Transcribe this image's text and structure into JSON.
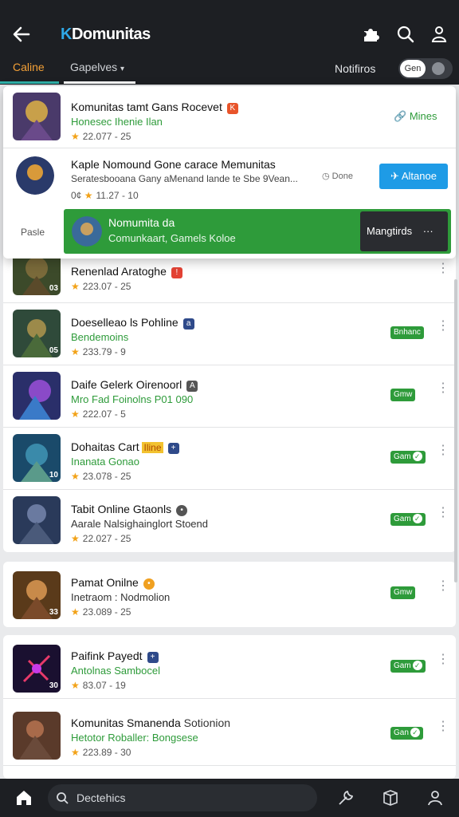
{
  "header": {
    "title_k": "K",
    "title_rest": "Domunitas",
    "back_icon": "back-arrow-icon",
    "icons": [
      "puzzle-icon",
      "search-icon",
      "user-icon"
    ]
  },
  "tabs": {
    "active": "Caline",
    "second": "Gapelves",
    "notifications_label": "Notifiros",
    "toggle_label": "Gen"
  },
  "popup": {
    "row1": {
      "title": "Komunitas tamt Gans Rocevet",
      "badge": "K",
      "sub": "Honesec Ihenie Ilan",
      "meta": "22.077 - 25",
      "action": "Mines"
    },
    "row2": {
      "title": "Kaple Nomound Gone carace Memunitas",
      "desc": "Seratesbooana Gany aMenand lande te Sbe 9Vean...",
      "done": "Done",
      "meta": "11.27 - 10",
      "meta_prefix": "0¢",
      "button": "Altanoe"
    },
    "paste_label": "Pasle",
    "toast": {
      "title": "Nomumita da",
      "subtitle": "Comunkaart, Gamels Koloe",
      "action": "Mangtirds",
      "more": "···"
    }
  },
  "list": [
    {
      "title": "Renenlad Aratoghe",
      "badge": "!",
      "badge_color": "#e34234",
      "sub": "",
      "meta": "223.07 - 25",
      "status": "",
      "level": "03"
    },
    {
      "title": "Doeselleao ls Pohline",
      "badge": "a",
      "badge_color": "#2f4a8a",
      "sub": "Bendemoins",
      "meta": "233.79 - 9",
      "status": "Bnhanc",
      "level": "05"
    },
    {
      "title": "Daife Gelerk Oirenoorl",
      "badge": "A",
      "badge_color": "#555",
      "sub": "Mro Fad Foinolns P01 090",
      "meta": "222.07 - 5",
      "status": "Gmw",
      "level": ""
    },
    {
      "title": "Dohaitas Cart",
      "badge_text": "Iline",
      "badge": "+",
      "badge_color": "#2f4a8a",
      "sub": "Inanata Gonao",
      "meta": "23.078 - 25",
      "status": "Gam",
      "level": "10"
    },
    {
      "title": "Tabit Online Gtaonls",
      "badge": "•",
      "badge_color": "#555",
      "sub": "Aarale Nalsighainglort Stoend",
      "meta": "22.027 - 25",
      "status": "Gam",
      "level": ""
    },
    {
      "title": "Pamat Onilne",
      "badge": "•",
      "badge_color": "#f0a020",
      "sub": "Inetraom : Nodmolion",
      "meta": "23.089 - 25",
      "status": "Gmw",
      "level": "33"
    },
    {
      "title": "Paifink Payedt",
      "badge": "+",
      "badge_color": "#2f4a8a",
      "sub": "Antolnas Sambocel",
      "meta": "83.07 - 19",
      "status": "Gam",
      "level": "30"
    },
    {
      "title": "Komunitas Smanenda",
      "badge_text": "Sotionion",
      "badge": "",
      "badge_color": "#a05020",
      "sub": "Hetotor Roballer: Bongsese",
      "meta": "223.89 - 30",
      "status": "Gan",
      "level": ""
    }
  ],
  "bottom": {
    "search_label": "Dectehics",
    "icons": [
      "home-icon",
      "search-icon",
      "wrench-icon",
      "cube-icon",
      "user-icon"
    ]
  },
  "colors": {
    "accent_green": "#2e9b3a",
    "accent_blue": "#1e9be6",
    "accent_orange": "#f3a037",
    "dark_bar": "#1d1f23"
  }
}
